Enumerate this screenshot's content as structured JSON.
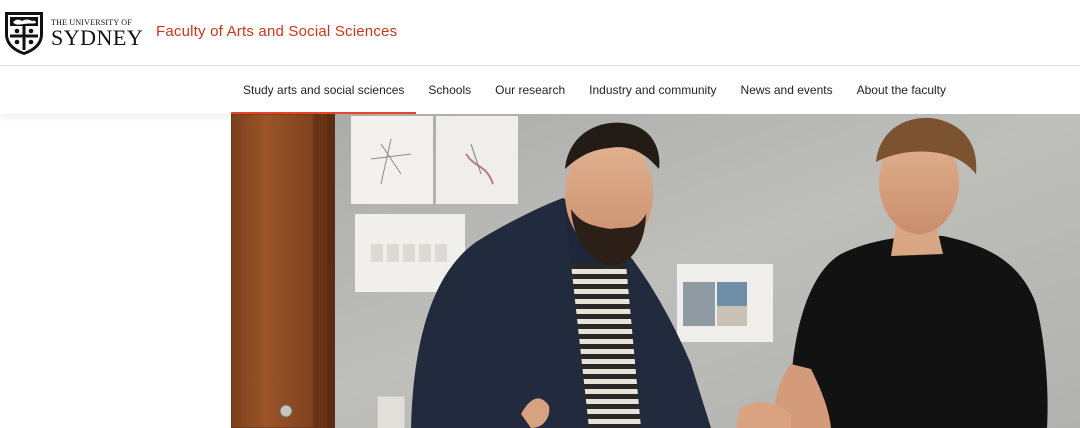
{
  "header": {
    "logo": {
      "line1": "THE UNIVERSITY OF",
      "line2": "SYDNEY"
    },
    "faculty_title": "Faculty of Arts and Social Sciences",
    "accent_color": "#e64626",
    "title_color": "#c7361a"
  },
  "nav": {
    "items": [
      {
        "label": "Study arts and social sciences",
        "active": true
      },
      {
        "label": "Schools",
        "active": false
      },
      {
        "label": "Our research",
        "active": false
      },
      {
        "label": "Industry and community",
        "active": false
      },
      {
        "label": "News and events",
        "active": false
      },
      {
        "label": "About the faculty",
        "active": false
      }
    ]
  },
  "hero": {
    "icon": "hero-photo"
  }
}
